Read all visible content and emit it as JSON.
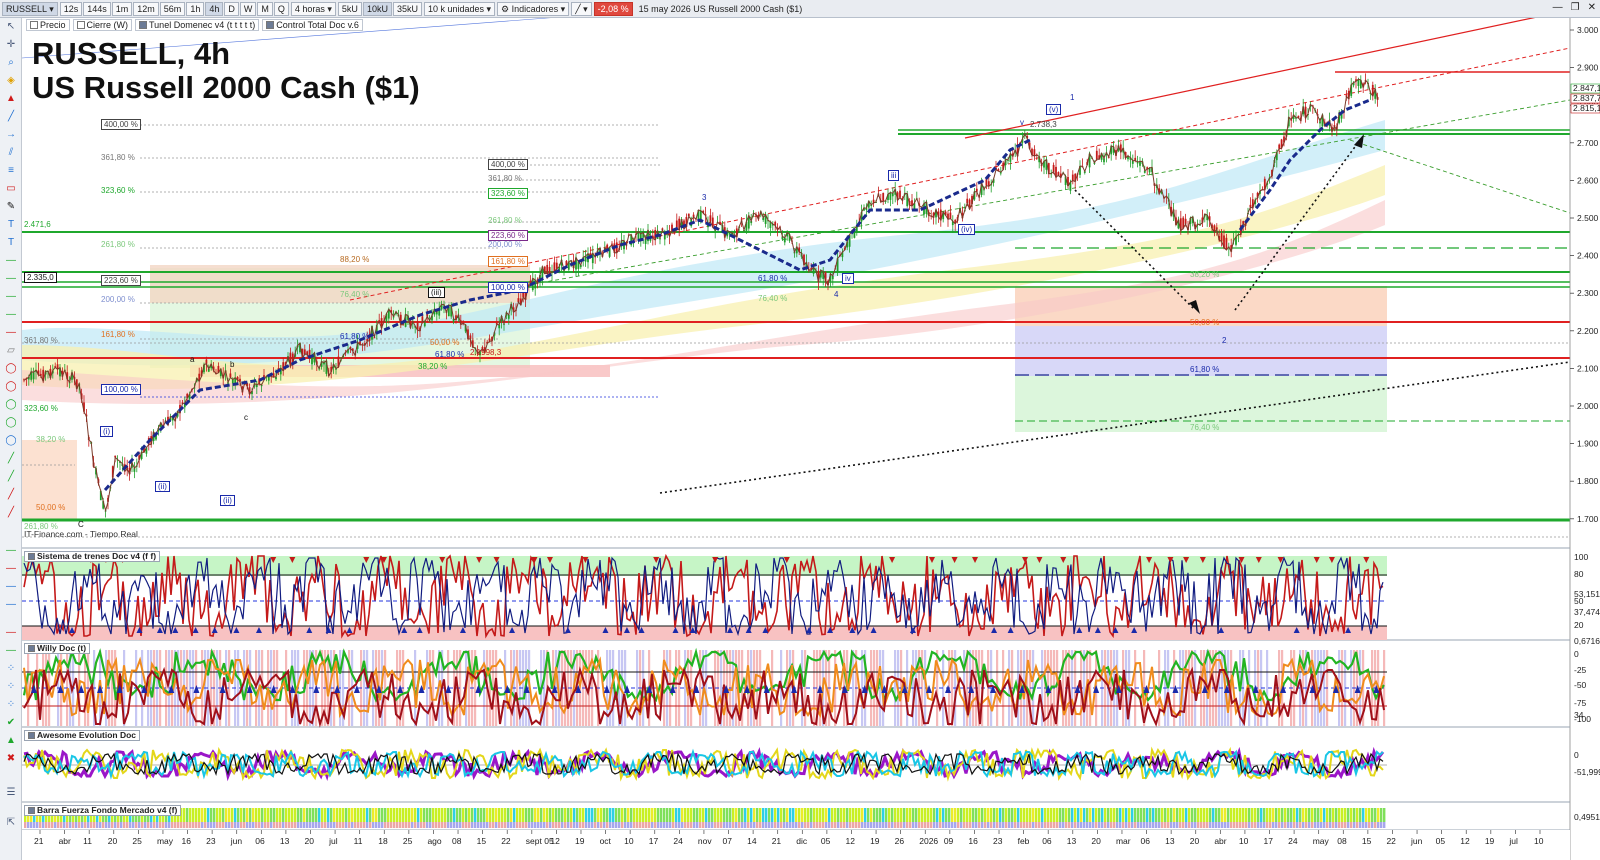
{
  "toolbar": {
    "symbol": "RUSSELL",
    "timeframes": [
      "12s",
      "144s",
      "1m",
      "12m",
      "56m",
      "1h",
      "4h",
      "D",
      "W",
      "M",
      "Q"
    ],
    "selected_timeframe": "4h",
    "period_select": "4 horas",
    "volume_options": [
      "5kU",
      "10kU",
      "35kU"
    ],
    "selected_volume": "10kU",
    "units_select": "10 k unidades",
    "indicators_label": "Indicadores",
    "change_badge": "-2,08 %",
    "window_title": "15 may 2026 US Russell 2000 Cash ($1)"
  },
  "overlays": {
    "items": [
      "Precio",
      "Cierre (W)",
      "Tunel Domenec v4 (t t t t t)",
      "Control Total Doc v.6"
    ]
  },
  "chart_title": {
    "line1": "RUSSELL, 4h",
    "line2": "US Russell 2000 Cash ($1)"
  },
  "source_label": "IT-Finance.com - Tiempo Real",
  "panels": {
    "p1": "Sistema de trenes Doc v4 (f f)",
    "p2": "Willy Doc (t)",
    "p3": "Awesome Evolution Doc",
    "p4": "Barra Fuerza Fondo Mercado v4 (f)"
  },
  "price_axis": {
    "ticks": [
      "3.000",
      "2.900",
      "2.800",
      "2.700",
      "2.600",
      "2.500",
      "2.400",
      "2.300",
      "2.200",
      "2.100",
      "2.000",
      "1.900",
      "1.800",
      "1.700"
    ],
    "last_price_tags": [
      "2.847,1",
      "2.837,7",
      "2.815,1"
    ]
  },
  "panel_axes": {
    "p1": [
      "100",
      "80",
      "53,151",
      "50",
      "37,474",
      "20",
      "0,6716"
    ],
    "p2": [
      "0",
      "-25",
      "-50",
      "-75",
      "-100",
      "34"
    ],
    "p3": [
      "0",
      "-51,999"
    ],
    "p4": [
      "0,4951"
    ]
  },
  "time_axis": [
    "21",
    "abr",
    "11",
    "20",
    "25",
    "may",
    "16",
    "23",
    "jun",
    "06",
    "13",
    "20",
    "jul",
    "11",
    "18",
    "25",
    "ago",
    "08",
    "15",
    "22",
    "sept 05",
    "12",
    "19",
    "oct",
    "10",
    "17",
    "24",
    "nov",
    "07",
    "14",
    "21",
    "dic",
    "05",
    "12",
    "19",
    "26",
    "2026",
    "09",
    "16",
    "23",
    "feb",
    "06",
    "13",
    "20",
    "mar",
    "06",
    "13",
    "20",
    "abr",
    "10",
    "17",
    "24",
    "may",
    "08",
    "15",
    "22",
    "jun",
    "05",
    "12",
    "19",
    "jul",
    "10"
  ],
  "fib_labels": {
    "left": [
      "400,00 %",
      "361,80 %",
      "323,60 %",
      "2.471,6",
      "261,80 %",
      "2.335,0",
      "223,60 %",
      "200,00 %",
      "161,80 %",
      "361,80 %",
      "100,00 %",
      "323,60 %",
      "38,20 %",
      "50,00 %",
      "261,80 %"
    ],
    "mid": [
      "400,00 %",
      "361,80 %",
      "323,60 %",
      "261,80 %",
      "223,60 %",
      "200,00 %",
      "161,80 %",
      "100,00 %",
      "88,20 %",
      "76,40 %",
      "61,80 %",
      "50,00 %",
      "38,20 %",
      "61,80 %",
      "2.1998,3"
    ],
    "right": [
      "61,80 %",
      "76,40 %",
      "38,20 %",
      "50,00 %",
      "61,80 %",
      "76,40 %",
      "2.738,3"
    ]
  },
  "wave_labels": [
    "(i)",
    "(ii)",
    "(ii)",
    "(iii)",
    "(iv)",
    "(v)",
    "1",
    "2",
    "3",
    "4",
    "iii",
    "iv",
    "v",
    "a",
    "b",
    "c",
    "C"
  ],
  "colors": {
    "up_candle": "#1e9e2a",
    "down_candle": "#c41a1a",
    "support_green": "#1fa82d",
    "resistance_red": "#e02020",
    "trend_blue": "#1a2a8c",
    "panel_green": "#b9f5b9",
    "panel_red": "#f8c2c2"
  }
}
